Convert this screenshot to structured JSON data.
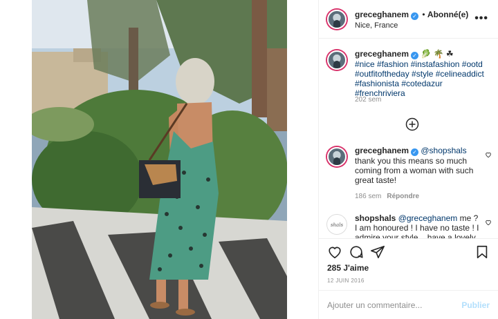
{
  "post": {
    "photo_description_icon": "photo",
    "author": {
      "username": "greceghanem",
      "verified": true,
      "separator": "•",
      "follow_status": "Abonné(e)",
      "location": "Nice, France"
    },
    "more_icon": "more-horizontal-icon",
    "more_label": "•••",
    "caption": {
      "username": "greceghanem",
      "emojis": "🥬 🌴 ☘",
      "text": "#nice #fashion #instafashion #ootd #outfitoftheday #style #celineaddict #fashionista #cotedazur #frenchriviera",
      "time": "202 sem"
    },
    "load_more_icon": "plus-circle-icon",
    "comments": [
      {
        "username": "greceghanem",
        "verified": true,
        "mention": "@shopshals",
        "text": "thank you this means so much coming from a woman with such great taste!",
        "time": "186 sem",
        "reply_label": "Répondre"
      },
      {
        "username": "shopshals",
        "avatar_text": "shals",
        "mention": "@greceghanem",
        "text": "me ? I am honoured ! I have no taste ! I admire your style... have a lovely"
      }
    ],
    "likes": "285 J'aime",
    "date": "12 JUIN 2016",
    "add_comment": {
      "placeholder": "Ajouter un commentaire...",
      "publish_label": "Publier"
    }
  },
  "colors": {
    "link": "#00376b",
    "verified": "#3897f0",
    "publish_disabled": "#b2dffc",
    "muted": "#8e8e8e",
    "story_ring": "#d8336b"
  }
}
